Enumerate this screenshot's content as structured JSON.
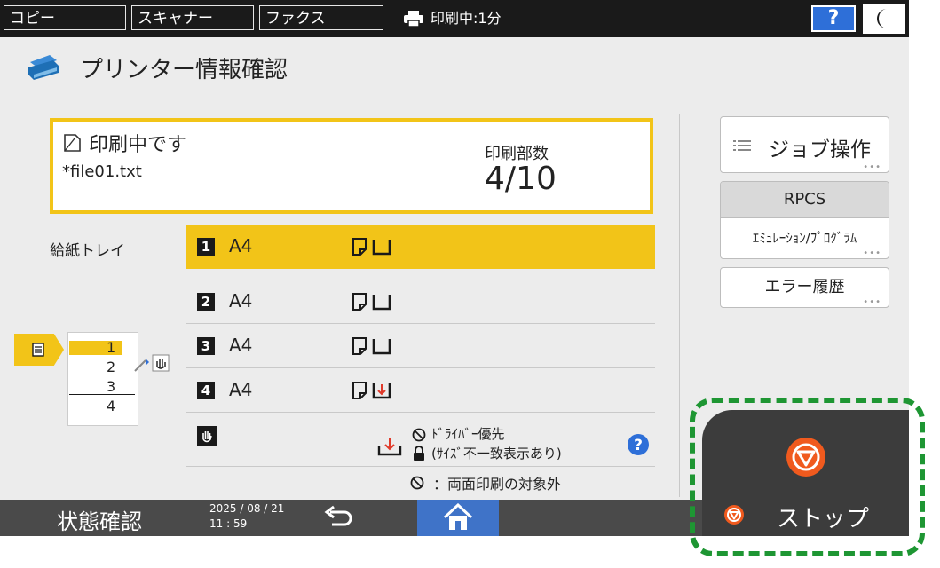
{
  "topbar": {
    "tabs": [
      "コピー",
      "スキャナー",
      "ファクス"
    ],
    "status_text": "印刷中:1分",
    "help_label": "?",
    "moon_label": "☾"
  },
  "title": "プリンター情報確認",
  "job": {
    "state": "印刷中です",
    "file": "*file01.txt",
    "copies_label": "印刷部数",
    "copies_value": "4/10"
  },
  "side_buttons": {
    "job_ops": "ジョブ操作",
    "rpcs": "RPCS",
    "emulation": "ｴﾐｭﾚｰｼｮﾝ/ﾌﾟﾛｸﾞﾗﾑ",
    "error_history": "エラー履歴"
  },
  "tray_label": "給紙トレイ",
  "trays": [
    {
      "num": "1",
      "size": "A4"
    },
    {
      "num": "2",
      "size": "A4"
    },
    {
      "num": "3",
      "size": "A4"
    },
    {
      "num": "4",
      "size": "A4"
    }
  ],
  "tray_diagram_numbers": [
    "1",
    "2",
    "3",
    "4"
  ],
  "legend": {
    "driver_priority": "ﾄﾞﾗｲﾊﾞｰ優先",
    "size_mismatch": "(ｻｲｽﾞ不一致表示あり)",
    "duplex_excluded": "：両面印刷の対象外"
  },
  "bottombar": {
    "status_label": "状態確認",
    "date": "2025 / 08 / 21",
    "time": "11 : 59"
  },
  "stop": {
    "label": "ストップ"
  },
  "colors": {
    "accent_yellow": "#f2c418",
    "help_blue": "#2e6fd8",
    "stop_orange": "#f05a1e",
    "highlight_green": "#1e9633",
    "home_blue": "#3f73c8"
  }
}
